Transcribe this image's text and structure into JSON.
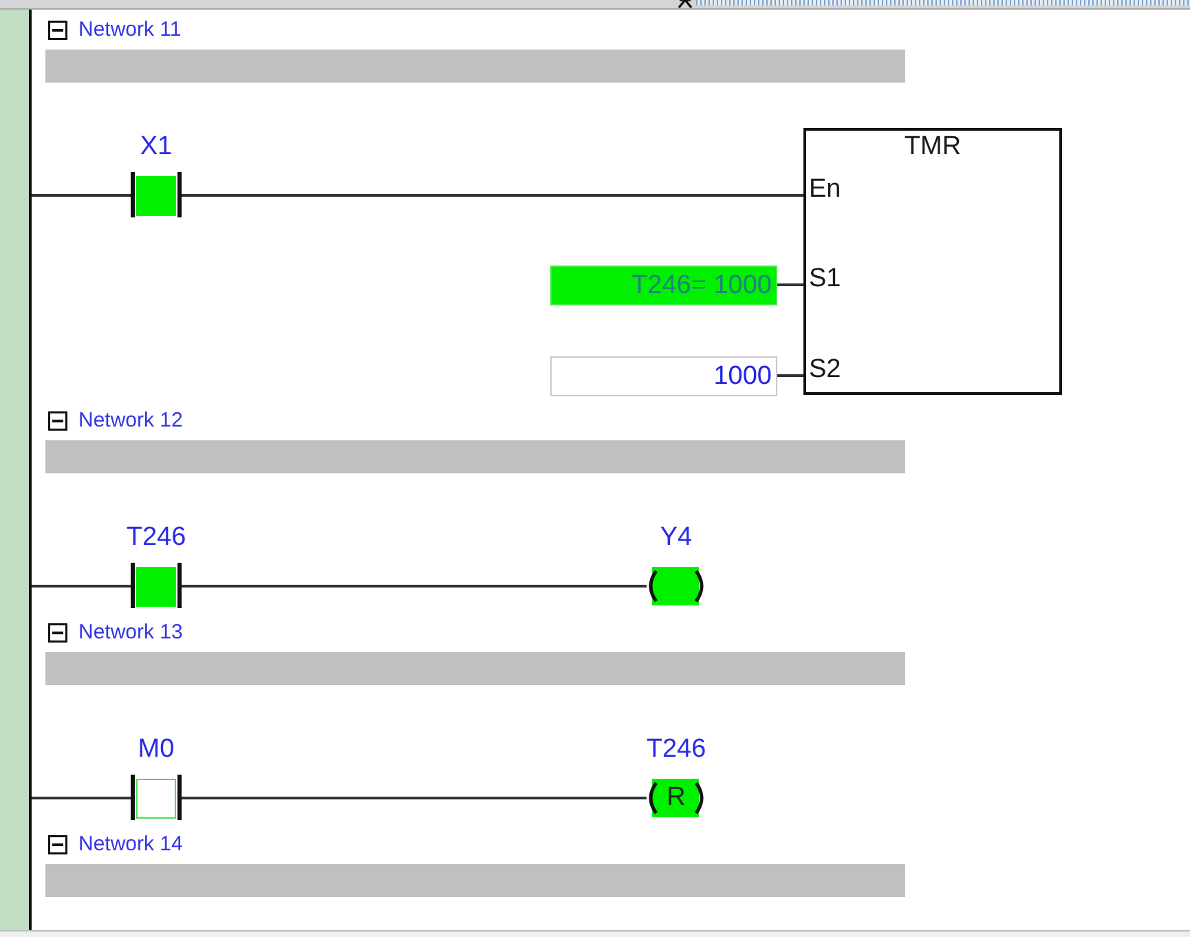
{
  "networks": [
    {
      "title": "Network 11",
      "expanded": true,
      "elements": [
        {
          "kind": "contact",
          "label": "X1",
          "on": true
        },
        {
          "kind": "block",
          "name": "TMR",
          "pins": [
            {
              "pin": "En"
            },
            {
              "pin": "S1",
              "operand": "T246= 1000",
              "on": true
            },
            {
              "pin": "S2",
              "operand": "1000",
              "on": false
            }
          ]
        }
      ]
    },
    {
      "title": "Network 12",
      "expanded": true,
      "elements": [
        {
          "kind": "contact",
          "label": "T246",
          "on": true
        },
        {
          "kind": "coil",
          "label": "Y4",
          "on": true
        }
      ]
    },
    {
      "title": "Network 13",
      "expanded": true,
      "elements": [
        {
          "kind": "contact",
          "label": "M0",
          "on": false
        },
        {
          "kind": "coil",
          "label": "T246",
          "on": true,
          "letter": "R"
        }
      ]
    },
    {
      "title": "Network 14",
      "expanded": true
    }
  ]
}
